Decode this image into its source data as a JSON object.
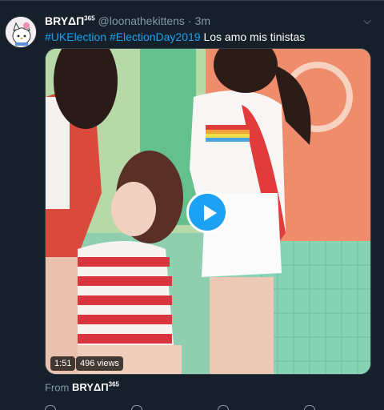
{
  "tweet": {
    "author_name": "BRYΔП",
    "author_sup": "365",
    "handle": "@loonathekittens",
    "separator": "·",
    "time": "3m",
    "hashtag1": "#UKElection",
    "hashtag2": "#ElectionDay2019",
    "body_text": "Los amo mis tinistas",
    "video": {
      "duration": "1:51",
      "views": "496 views"
    },
    "from_label": "From",
    "from_name": "BRYΔП",
    "from_sup": "365"
  },
  "icons": {
    "caret": "chevron-down-icon",
    "play": "play-icon"
  },
  "colors": {
    "background": "#15202b",
    "accent": "#1da1f2",
    "muted": "#8899a6"
  }
}
